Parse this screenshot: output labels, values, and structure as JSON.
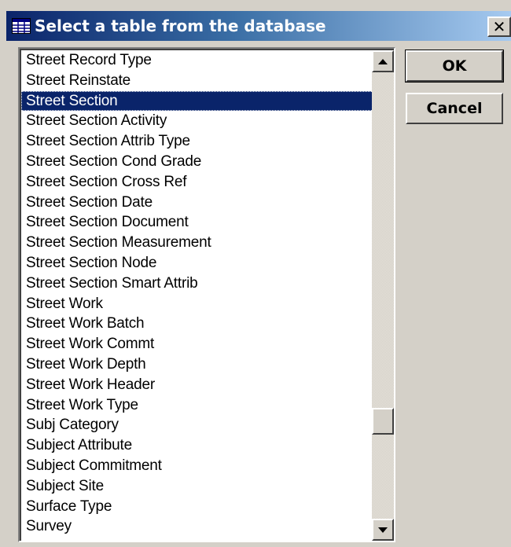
{
  "dialog": {
    "title": "Select a table from the database",
    "close_label": "✕"
  },
  "buttons": {
    "ok_label": "OK",
    "cancel_label": "Cancel"
  },
  "list": {
    "selected_index": 2,
    "items": [
      "Street Record Type",
      "Street Reinstate",
      "Street Section",
      "Street Section Activity",
      "Street Section Attrib Type",
      "Street Section Cond Grade",
      "Street Section Cross Ref",
      "Street Section Date",
      "Street Section Document",
      "Street Section Measurement",
      "Street Section Node",
      "Street Section Smart Attrib",
      "Street Work",
      "Street Work Batch",
      "Street Work Commt",
      "Street Work Depth",
      "Street Work Header",
      "Street Work Type",
      "Subj Category",
      "Subject Attribute",
      "Subject Commitment",
      "Subject Site",
      "Surface Type",
      "Survey"
    ]
  },
  "colors": {
    "selection_bg": "#0a246a",
    "title_gradient_start": "#0a246a",
    "title_gradient_end": "#a6caf0",
    "face": "#d4d0c8"
  },
  "icons": {
    "title": "table-icon",
    "close": "close-icon",
    "scroll_up": "scroll-up-arrow-icon",
    "scroll_down": "scroll-down-arrow-icon"
  }
}
